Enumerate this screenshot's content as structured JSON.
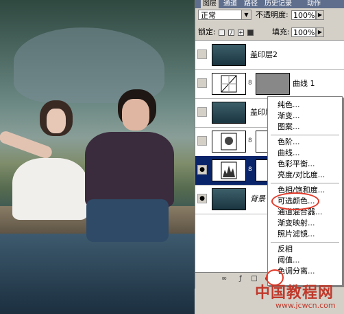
{
  "tabs": [
    "图层",
    "通道",
    "路径",
    "历史记录",
    "动作"
  ],
  "blend_mode": "正常",
  "opacity_label": "不透明度:",
  "opacity_value": "100%",
  "lock_label": "锁定:",
  "fill_label": "填充:",
  "fill_value": "100%",
  "layers": [
    {
      "name": "盖印层2",
      "type": "image",
      "visible": false
    },
    {
      "name": "曲线 1",
      "type": "curves",
      "visible": false
    },
    {
      "name": "盖印层",
      "type": "image",
      "visible": false
    },
    {
      "name": "",
      "type": "adjustment",
      "visible": false
    },
    {
      "name": "",
      "type": "levels",
      "visible": true,
      "selected": true
    },
    {
      "name": "背景",
      "type": "image",
      "visible": true
    }
  ],
  "menu_groups": [
    [
      "纯色...",
      "渐变...",
      "图案..."
    ],
    [
      "色阶...",
      "曲线...",
      "色彩平衡...",
      "亮度/对比度..."
    ],
    [
      "色相/饱和度...",
      "可选颜色...",
      "通道混合器...",
      "渐变映射...",
      "照片滤镜..."
    ],
    [
      "反相",
      "阈值...",
      "色调分离..."
    ]
  ],
  "watermark": {
    "title": "中国教程网",
    "url": "www.jcwcn.com"
  },
  "colors": {
    "highlight_circle": "#e23a2a",
    "selection": "#0a246a",
    "panel_bg": "#d4d0c8"
  }
}
